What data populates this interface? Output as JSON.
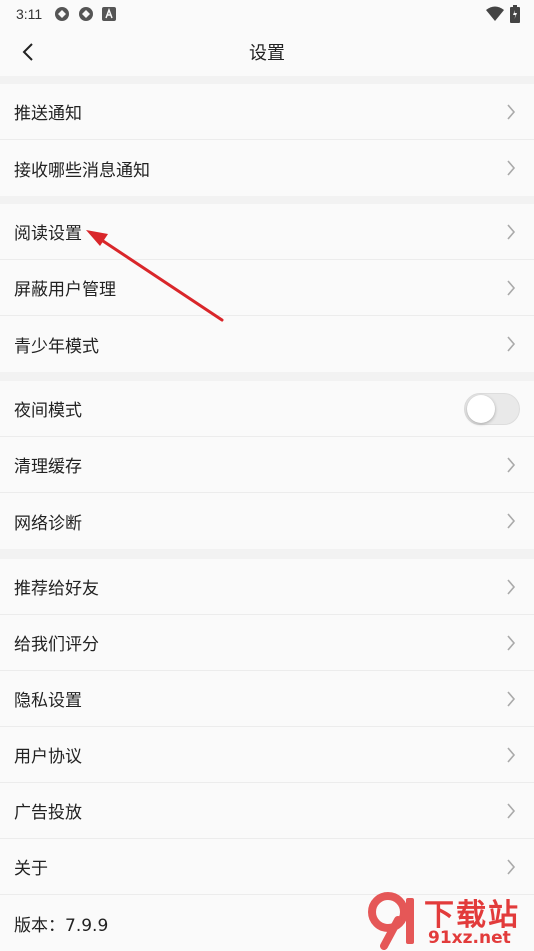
{
  "status_bar": {
    "time": "3:11"
  },
  "header": {
    "title": "设置"
  },
  "sections": [
    {
      "items": [
        {
          "label": "推送通知"
        },
        {
          "label": "接收哪些消息通知"
        }
      ]
    },
    {
      "items": [
        {
          "label": "阅读设置"
        },
        {
          "label": "屏蔽用户管理"
        },
        {
          "label": "青少年模式"
        }
      ]
    },
    {
      "items": [
        {
          "label": "夜间模式"
        },
        {
          "label": "清理缓存"
        },
        {
          "label": "网络诊断"
        }
      ]
    },
    {
      "items": [
        {
          "label": "推荐给好友"
        },
        {
          "label": "给我们评分"
        },
        {
          "label": "隐私设置"
        },
        {
          "label": "用户协议"
        },
        {
          "label": "广告投放"
        },
        {
          "label": "关于"
        }
      ]
    }
  ],
  "night_mode_enabled": false,
  "version_label": "版本：7.9.9",
  "watermark": {
    "text_top": "下载站",
    "text_bottom": "91xz.net"
  },
  "colors": {
    "annotation_arrow": "#d9262a",
    "background": "#f2f2f2",
    "panel": "#fafafa"
  }
}
